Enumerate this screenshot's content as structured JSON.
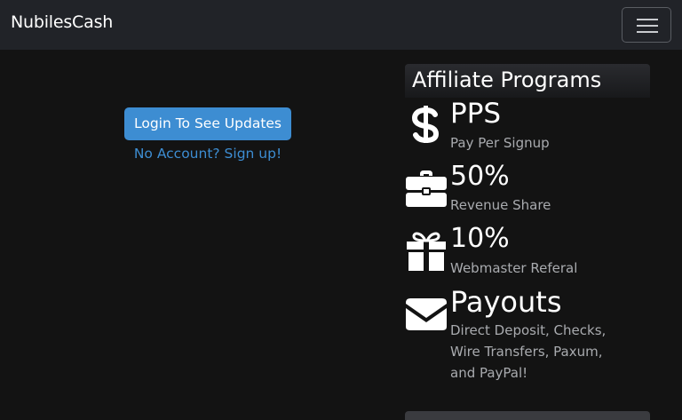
{
  "navbar": {
    "brand": "NubilesCash",
    "menu_icon": "hamburger-menu-icon"
  },
  "main": {
    "login_button": "Login To See Updates",
    "signup_link": "No Account? Sign up!"
  },
  "affiliate": {
    "title": "Affiliate Programs",
    "items": [
      {
        "icon": "dollar-icon",
        "title": "PPS",
        "subtitle": "Pay Per Signup"
      },
      {
        "icon": "briefcase-icon",
        "title": "50%",
        "subtitle": "Revenue Share"
      },
      {
        "icon": "gift-icon",
        "title": "10%",
        "subtitle": "Webmaster Referal"
      },
      {
        "icon": "envelope-icon",
        "title": "Payouts",
        "subtitle": "Direct Deposit, Checks, Wire Transfers, Paxum, and PayPal!"
      }
    ]
  },
  "colors": {
    "background": "#131313",
    "navbar": "#212328",
    "accent": "#3d8dd2",
    "muted_text": "#a9abaf"
  }
}
